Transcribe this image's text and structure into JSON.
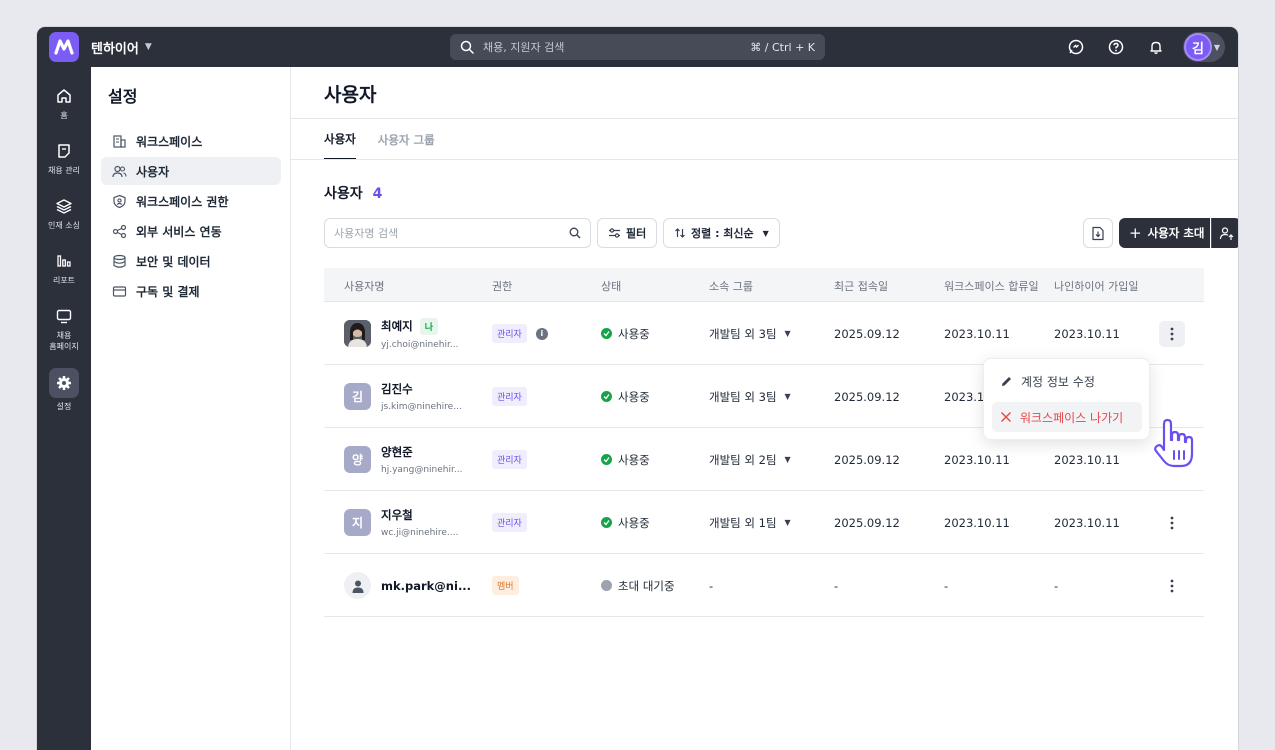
{
  "topbar": {
    "company_name": "텐하이어",
    "search_placeholder": "채용, 지원자 검색",
    "search_shortcut": "⌘ / Ctrl + K",
    "avatar_initial": "김"
  },
  "rail": {
    "items": [
      {
        "label": "홈",
        "icon": "home-icon"
      },
      {
        "label": "채용 관리",
        "icon": "clipboard-icon"
      },
      {
        "label": "인재 소싱",
        "icon": "layers-icon"
      },
      {
        "label": "리포트",
        "icon": "bar-chart-icon"
      },
      {
        "label_line1": "채용",
        "label_line2": "홈페이지",
        "icon": "monitor-icon"
      },
      {
        "label": "설정",
        "icon": "gear-icon",
        "active": true
      }
    ]
  },
  "settings": {
    "title": "설정",
    "items": [
      {
        "label": "워크스페이스",
        "icon": "building-icon"
      },
      {
        "label": "사용자",
        "icon": "users-icon",
        "active": true
      },
      {
        "label": "워크스페이스 권한",
        "icon": "shield-icon"
      },
      {
        "label": "외부 서비스 연동",
        "icon": "share-icon"
      },
      {
        "label": "보안 및 데이터",
        "icon": "database-icon"
      },
      {
        "label": "구독 및 결제",
        "icon": "card-icon"
      }
    ]
  },
  "main": {
    "title": "사용자",
    "tabs": [
      "사용자",
      "사용자 그룹"
    ],
    "section_title": "사용자",
    "user_count": "4",
    "user_search_placeholder": "사용자명 검색",
    "filter_label": "필터",
    "sort_label": "정렬 : 최신순",
    "invite_label": "사용자 초대"
  },
  "table": {
    "headers": [
      "사용자명",
      "권한",
      "상태",
      "소속 그룹",
      "최근 접속일",
      "워크스페이스 합류일",
      "나인하이어 가입일"
    ],
    "rows": [
      {
        "name": "최예지",
        "email": "yj.choi@ninehir...",
        "me_tag": "나",
        "role": "관리자",
        "status": "사용중",
        "group": "개발팀 외 3팀",
        "last_login": "2025.09.12",
        "joined_ws": "2023.10.11",
        "joined_nh": "2023.10.11"
      },
      {
        "initial": "김",
        "name": "김진수",
        "email": "js.kim@ninehire...",
        "role": "관리자",
        "status": "사용중",
        "group": "개발팀 외 3팀",
        "last_login": "2025.09.12",
        "joined_ws": "2023.10.11",
        "joined_nh": ""
      },
      {
        "initial": "양",
        "name": "양현준",
        "email": "hj.yang@ninehir...",
        "role": "관리자",
        "status": "사용중",
        "group": "개발팀 외 2팀",
        "last_login": "2025.09.12",
        "joined_ws": "2023.10.11",
        "joined_nh": "2023.10.11"
      },
      {
        "initial": "지",
        "name": "지우철",
        "email": "wc.ji@ninehire....",
        "role": "관리자",
        "status": "사용중",
        "group": "개발팀 외 1팀",
        "last_login": "2025.09.12",
        "joined_ws": "2023.10.11",
        "joined_nh": "2023.10.11"
      },
      {
        "name": "mk.park@ni...",
        "role": "멤버",
        "status": "초대 대기중",
        "group": "-",
        "last_login": "-",
        "joined_ws": "-",
        "joined_nh": "-"
      }
    ]
  },
  "context_menu": {
    "edit_label": "계정 정보 수정",
    "leave_label": "워크스페이스 나가기"
  },
  "colors": {
    "brand": "#7b5cf5",
    "sidebar_dark": "#2b303b",
    "danger": "#e5484d",
    "success": "#16a34a"
  }
}
